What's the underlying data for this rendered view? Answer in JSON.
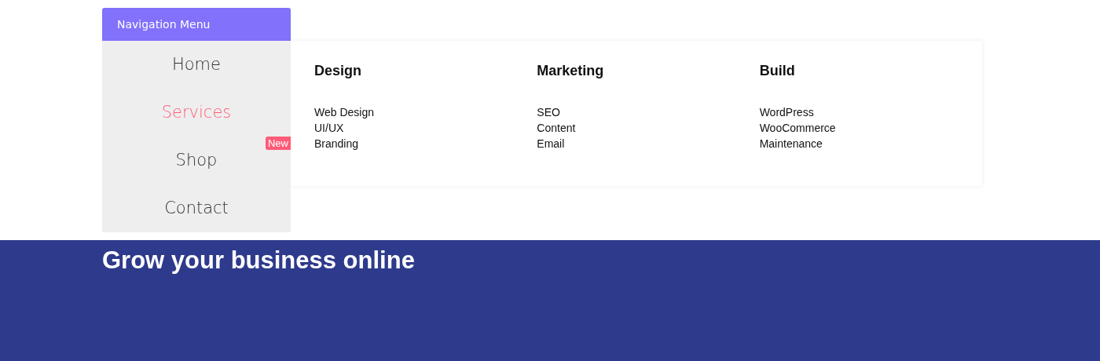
{
  "nav_menu": {
    "title": "Navigation Menu",
    "items": [
      {
        "label": "Home",
        "selected": false
      },
      {
        "label": "Services",
        "selected": true
      },
      {
        "label": "Shop",
        "selected": false,
        "badge": "New"
      },
      {
        "label": "Contact",
        "selected": false
      }
    ]
  },
  "mega_menu": {
    "columns": [
      {
        "heading": "Design",
        "links": [
          "Web Design",
          "UI/UX",
          "Branding"
        ]
      },
      {
        "heading": "Marketing",
        "links": [
          "SEO",
          "Content",
          "Email"
        ]
      },
      {
        "heading": "Build",
        "links": [
          "WordPress",
          "WooCommerce",
          "Maintenance"
        ]
      }
    ]
  },
  "hero": {
    "heading": "Grow your business online"
  }
}
